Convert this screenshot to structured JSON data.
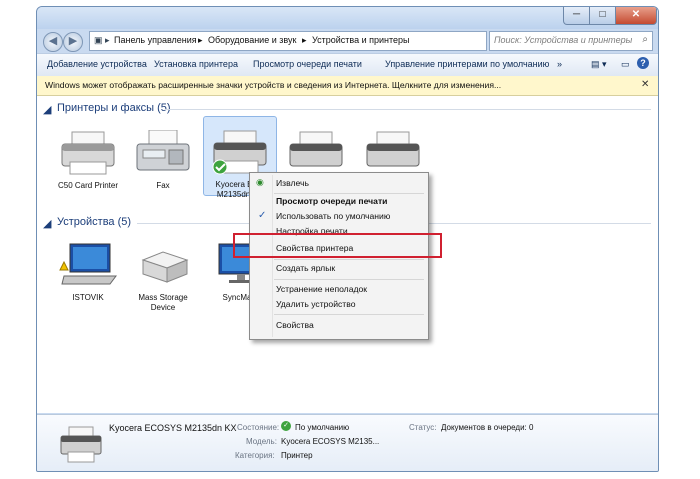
{
  "window": {
    "minimize": "─",
    "maximize": "□",
    "close": "✕"
  },
  "address": {
    "crumbs": [
      "Панель управления",
      "Оборудование и звук",
      "Устройства и принтеры"
    ],
    "separator": "▸",
    "search_placeholder": "Поиск: Устройства и принтеры"
  },
  "toolbar": {
    "add_device": "Добавление устройства",
    "add_printer": "Установка принтера",
    "view_queue": "Просмотр очереди печати",
    "manage_default": "Управление принтерами по умолчанию",
    "more": "»"
  },
  "infobar": {
    "text": "Windows может отображать расширенные значки устройств и сведения из Интернета. Щелкните для изменения...",
    "close": "✕"
  },
  "groups": {
    "printers": {
      "title": "Принтеры и факсы (5)",
      "items": [
        {
          "label": "C50 Card Printer"
        },
        {
          "label": "Fax"
        },
        {
          "label_line1": "Kyocera ECO",
          "label_line2": "M2135dn KX"
        },
        {
          "label": ""
        },
        {
          "label": ""
        }
      ]
    },
    "devices": {
      "title": "Устройства (5)",
      "items": [
        {
          "label": "ISTOVIK"
        },
        {
          "label_line1": "Mass Storage",
          "label_line2": "Device"
        },
        {
          "label": "SyncMas"
        }
      ]
    }
  },
  "context_menu": {
    "items": [
      "Извлечь",
      "Просмотр очереди печати",
      "Использовать по умолчанию",
      "Настройка печати",
      "Свойства принтера",
      "Создать ярлык",
      "Устранение неполадок",
      "Удалить устройство",
      "Свойства"
    ]
  },
  "details": {
    "name": "Kyocera ECOSYS M2135dn KX",
    "state_label": "Состояние:",
    "state_value": "По умолчанию",
    "status_label": "Статус:",
    "status_value": "Документов в очереди: 0",
    "model_label": "Модель:",
    "model_value": "Kyocera ECOSYS M2135...",
    "category_label": "Категория:",
    "category_value": "Принтер"
  },
  "colors": {
    "highlight_border": "#d02030",
    "link_text": "#1c3e7a",
    "infobar_bg": "#fff7cc"
  }
}
